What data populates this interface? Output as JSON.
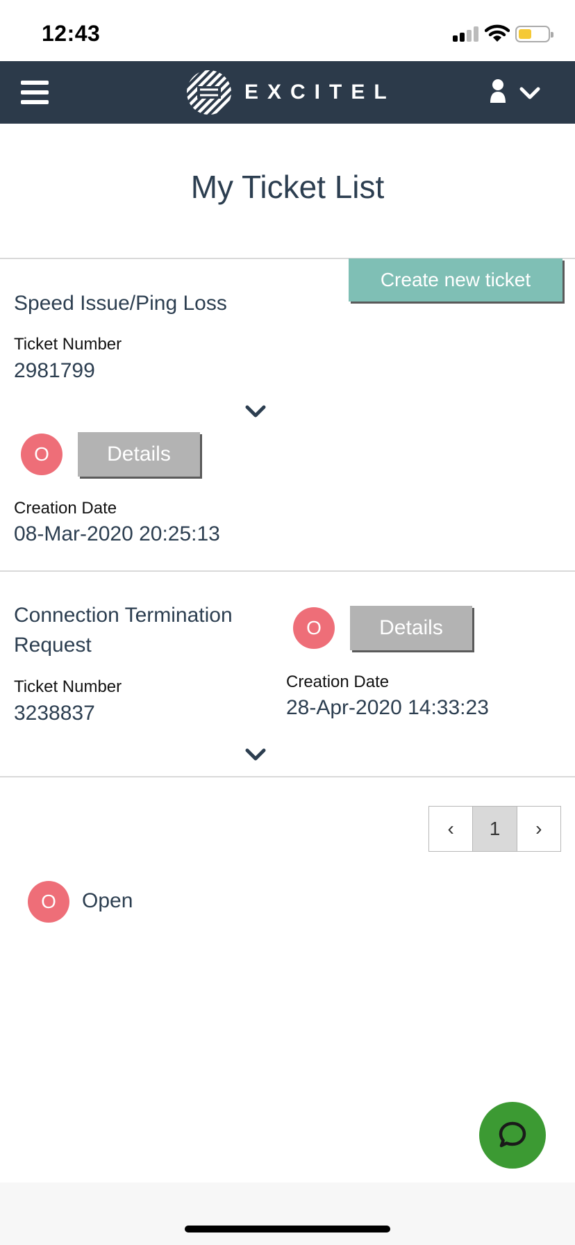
{
  "status_bar": {
    "time": "12:43",
    "icons": [
      "cellular-signal-icon",
      "wifi-icon",
      "battery-icon"
    ],
    "battery_color": "#f5c936"
  },
  "navbar": {
    "brand": "EXCITEL",
    "background": "#2c3a4a",
    "icons": [
      "hamburger-menu-icon",
      "excitel-logo-icon",
      "user-icon",
      "chevron-down-icon"
    ]
  },
  "page": {
    "title": "My Ticket List",
    "create_button": "Create new ticket"
  },
  "tickets": [
    {
      "title": "Speed Issue/Ping Loss",
      "ticket_number_label": "Ticket Number",
      "ticket_number": "2981799",
      "status_initial": "O",
      "details_button": "Details",
      "creation_date_label": "Creation Date",
      "creation_date": "08-Mar-2020 20:25:13"
    },
    {
      "title_line1": "Connection Termination",
      "title_line2": "Request",
      "ticket_number_label": "Ticket Number",
      "ticket_number": "3238837",
      "status_initial": "O",
      "details_button": "Details",
      "creation_date_label": "Creation Date",
      "creation_date": "28-Apr-2020 14:33:23"
    }
  ],
  "pagination": {
    "prev": "‹",
    "current": "1",
    "next": "›"
  },
  "legend": {
    "initial": "O",
    "label": "Open"
  },
  "colors": {
    "accent_teal": "#7fbfb5",
    "status_open": "#ee6e78",
    "details_gray": "#b3b3b3",
    "chat_green": "#3c9a33"
  },
  "chat": {
    "icon": "chat-bubble-icon"
  }
}
